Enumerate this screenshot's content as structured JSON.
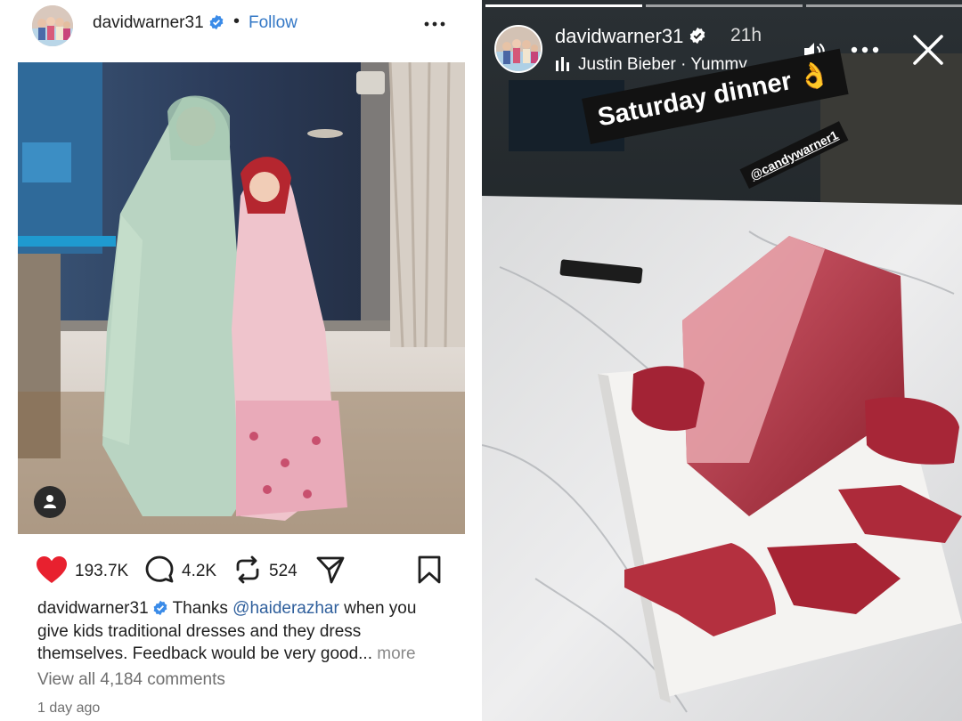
{
  "post": {
    "username": "davidwarner31",
    "separator": "•",
    "follow_label": "Follow",
    "stats": {
      "likes": "193.7K",
      "comments": "4.2K",
      "reposts": "524"
    },
    "caption": {
      "username": "davidwarner31",
      "text_before": " Thanks ",
      "mention": "@haiderazhar",
      "text_after": " when you give kids traditional dresses and they dress themselves. Feedback would be very good...",
      "more_label": " more"
    },
    "view_comments": "View all 4,184 comments",
    "timestamp": "1 day ago",
    "icons": [
      "verified-badge-icon",
      "more-options-icon",
      "heart-icon",
      "comment-icon",
      "repost-icon",
      "share-icon",
      "bookmark-icon",
      "user-tag-icon"
    ]
  },
  "story": {
    "username": "davidwarner31",
    "time": "21h",
    "music": "Justin Bieber · Yummy",
    "sticker_text": "Saturday dinner 👌",
    "mention_sticker": "@candywarner1",
    "icons": [
      "music-bars-icon",
      "speaker-icon",
      "more-options-icon",
      "close-icon"
    ]
  },
  "colors": {
    "heart": "#e8212f",
    "follow": "#3478c6",
    "verified": "#3a8be8"
  }
}
